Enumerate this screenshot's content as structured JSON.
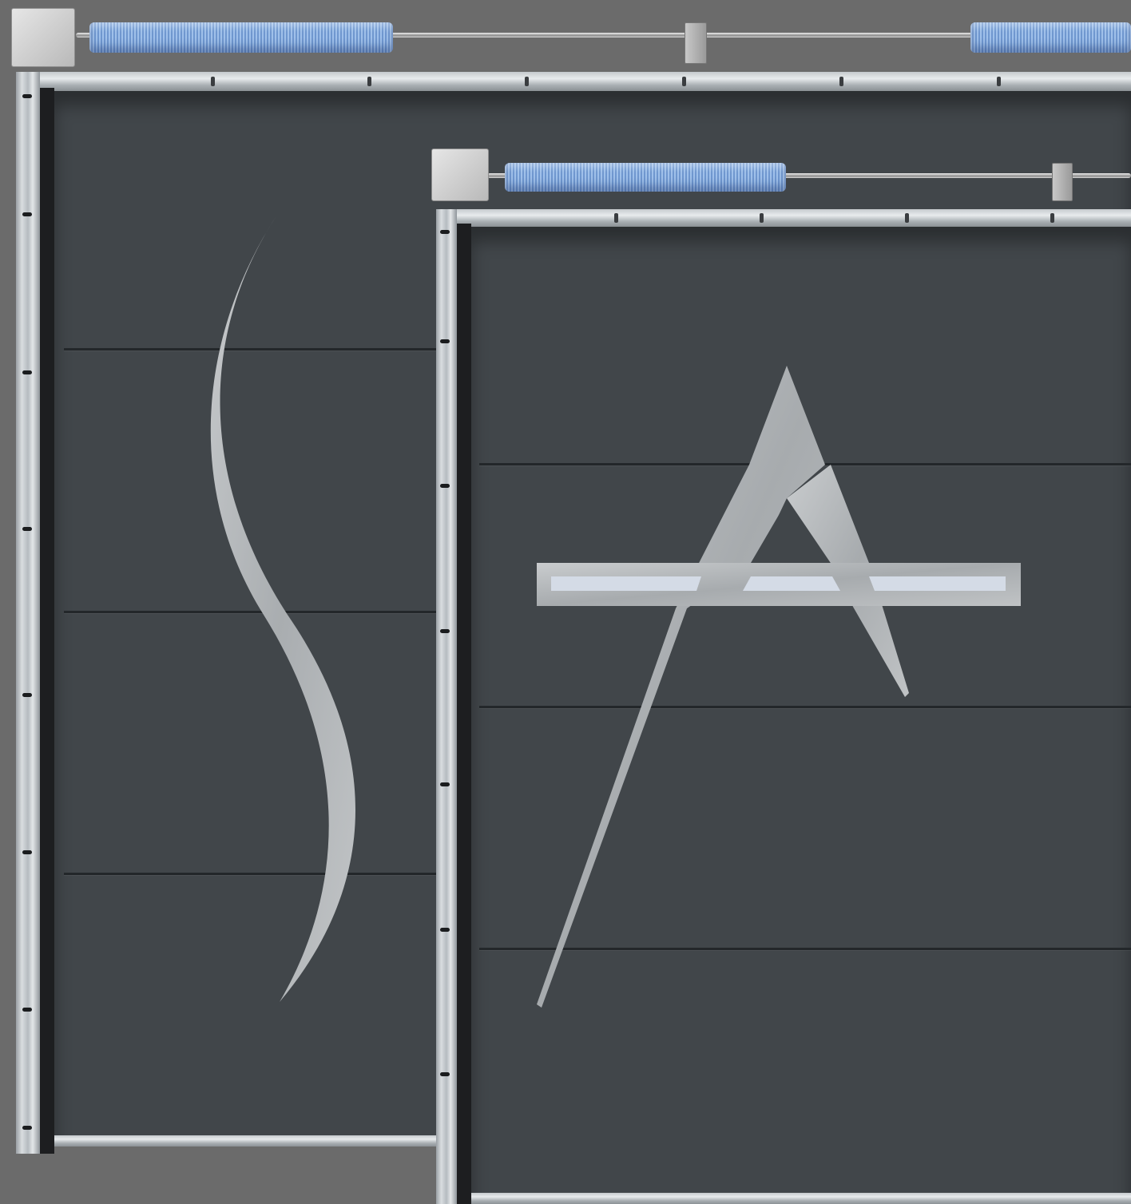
{
  "scene": {
    "description_free": true,
    "colors": {
      "background": "#6b6b6b",
      "door_panel": "#41464a",
      "spring": "#7fa6dc",
      "brushed_steel": "#b9bcbf",
      "frame": "#c8cdd0"
    },
    "doors": [
      {
        "motif": "s-curve-inlay",
        "panel_grooves": 3
      },
      {
        "motif": "a-emblem-inlay",
        "panel_grooves": 3
      }
    ]
  }
}
